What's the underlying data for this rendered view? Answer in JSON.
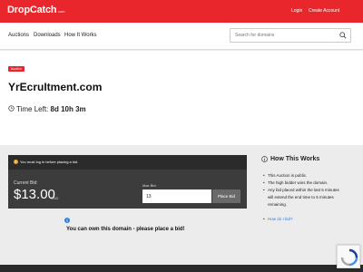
{
  "brand": {
    "name": "DropCatch",
    "tld": ".com",
    "accent": "#e8262b"
  },
  "header": {
    "login": "Login",
    "create_account": "Create Account"
  },
  "nav": {
    "items": [
      "Auctions",
      "Downloads",
      "How It Works"
    ],
    "search": {
      "placeholder": "Search for domains",
      "icon": "search-icon"
    }
  },
  "auction": {
    "badge": "Auction",
    "domain": "YrEcruItment.com",
    "time_left_label": "Time Left:",
    "time_left_value": "8d 10h 3m",
    "clock_icon": "clock-icon"
  },
  "bid": {
    "notice": "You must log in before placing a bid.",
    "current_label": "Current Bid:",
    "current_value": "$13.00",
    "currency": "USD",
    "max_label": "Max Bid:",
    "max_value": "13",
    "place_button": "Place Bid"
  },
  "promo": {
    "text": "You can own this domain - please place a bid!"
  },
  "how_it_works": {
    "title": "How This Works",
    "items": [
      "This Auction is public.",
      "The high bidder wins the domain.",
      "Any bid placed within the last 5 minutes"
    ],
    "continuation": [
      "will extend the end time to 5 minutes",
      "remaining."
    ],
    "link": "How do I bid?"
  }
}
